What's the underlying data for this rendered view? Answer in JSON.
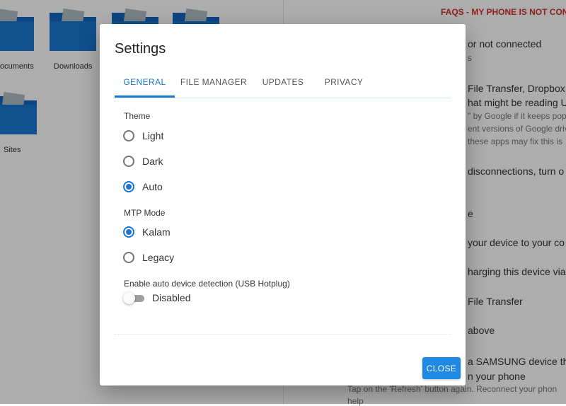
{
  "background": {
    "folders": [
      {
        "label": "Documents",
        "visible_label": "ocuments"
      },
      {
        "label": "Downloads",
        "visible_label": "Downloads"
      },
      {
        "label": "",
        "visible_label": ""
      },
      {
        "label": "",
        "visible_label": ""
      },
      {
        "label": "Sites",
        "visible_label": "Sites"
      }
    ],
    "faq": {
      "title": "FAQS - MY PHONE IS NOT CON",
      "lines": [
        "or not connected",
        "s",
        "File Transfer, Dropbox,",
        "hat might be reading U",
        "\" by Google if it keeps pop",
        "ent versions of Google driv",
        "these apps may fix this is",
        "disconnections, turn o",
        "e",
        "your device to your co",
        "harging this device via U",
        "File Transfer",
        "above",
        "a SAMSUNG device th",
        "n your phone",
        "Tap on the 'Refresh' button again. Reconnect your phon",
        "help"
      ]
    },
    "folder_color": "#1565c0"
  },
  "dialog": {
    "title": "Settings",
    "tabs": [
      {
        "label": "GENERAL",
        "active": true
      },
      {
        "label": "FILE MANAGER",
        "active": false
      },
      {
        "label": "UPDATES",
        "active": false
      },
      {
        "label": "PRIVACY",
        "active": false
      }
    ],
    "theme": {
      "label": "Theme",
      "options": [
        {
          "label": "Light",
          "checked": false
        },
        {
          "label": "Dark",
          "checked": false
        },
        {
          "label": "Auto",
          "checked": true
        }
      ]
    },
    "mtp_mode": {
      "label": "MTP Mode",
      "options": [
        {
          "label": "Kalam",
          "checked": true
        },
        {
          "label": "Legacy",
          "checked": false
        }
      ]
    },
    "hotplug": {
      "label": "Enable auto device detection (USB Hotplug)",
      "state_label": "Disabled",
      "enabled": false
    },
    "close_label": "CLOSE"
  },
  "colors": {
    "accent": "#1976d2",
    "close_button": "#1e88e5",
    "faq_title": "#d32f2f"
  }
}
